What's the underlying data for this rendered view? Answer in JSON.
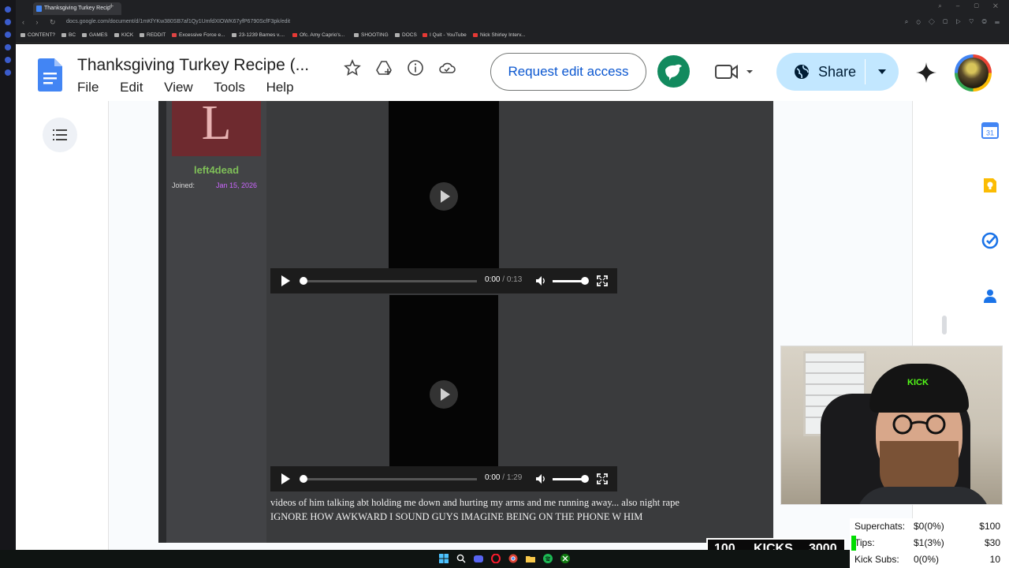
{
  "browser": {
    "tab_title": "Thanksgiving Turkey Recip",
    "url": "docs.google.com/document/d/1mKfYKw380SB7af1Qy1UmfdXIOWK67yfP6790ScfF3pk/edit",
    "bookmarks": [
      "CONTENT?",
      "BC",
      "GAMES",
      "KICK",
      "REDDIT",
      "Excessive Force e...",
      "23-1239 Barnes v....",
      "Ofc. Amy Caprio's...",
      "SHOOTING",
      "DOCS",
      "I Quit - YouTube",
      "Nick Shirley Interv..."
    ]
  },
  "docs": {
    "title": "Thanksgiving Turkey Recipe (...",
    "menus": [
      "File",
      "Edit",
      "View",
      "Tools",
      "Help"
    ],
    "request_edit_label": "Request edit access",
    "share_label": "Share",
    "colors": {
      "request_text": "#0b57d0",
      "share_bg": "#c2e7ff",
      "docs_blue": "#4285f4"
    }
  },
  "forum": {
    "avatar_letter": "L",
    "username": "left4dead",
    "joined_label": "Joined:",
    "joined_date": "Jan 15, 2026",
    "video1": {
      "current": "0:00",
      "sep": " / ",
      "duration": "0:13"
    },
    "video2": {
      "current": "0:00",
      "sep": " / ",
      "duration": "1:29"
    },
    "caption_line1": "videos of him talking abt holding me down and hurting my arms and me running away... also night rape",
    "caption_line2": "IGNORE HOW AWKWARD I SOUND GUYS IMAGINE BEING ON THE PHONE W HIM"
  },
  "webcam": {
    "cap_text": "KICK"
  },
  "kicks_bar": {
    "left": "100",
    "label": "KICKS",
    "right": "3000"
  },
  "stats": [
    {
      "label": "Superchats:",
      "value": "$0(0%)",
      "target": "$100"
    },
    {
      "label": "Tips:",
      "value": "$1(3%)",
      "target": "$30"
    },
    {
      "label": "Kick Subs:",
      "value": "0(0%)",
      "target": "10"
    }
  ]
}
